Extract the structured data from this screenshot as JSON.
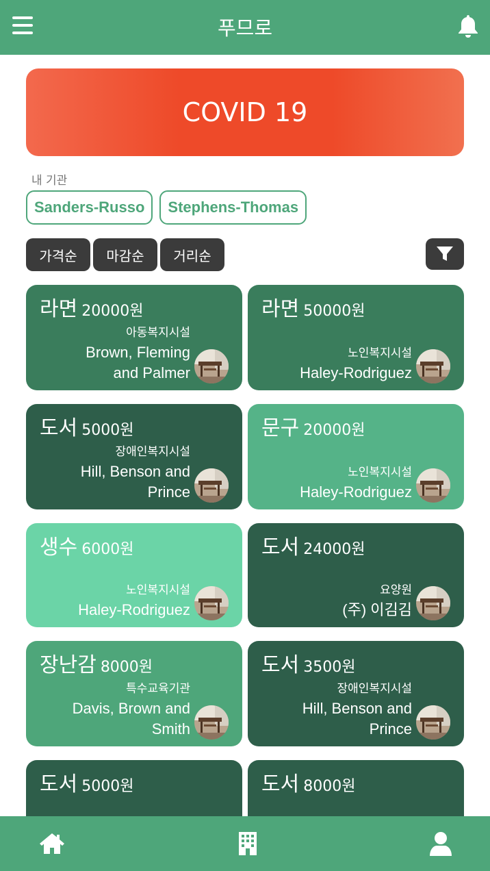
{
  "header": {
    "title": "푸므로",
    "menu_icon": "menu-icon",
    "bell_icon": "bell-icon"
  },
  "banner": {
    "text": "COVID 19"
  },
  "my_orgs": {
    "label": "내 기관",
    "items": [
      "Sanders-Russo",
      "Stephens-Thomas"
    ]
  },
  "sort": {
    "options": [
      "가격순",
      "마감순",
      "거리순"
    ],
    "filter_icon": "filter-icon"
  },
  "cards": [
    {
      "item": "라면",
      "price": "20000원",
      "type": "아동복지시설",
      "org_lines": [
        "Brown, Fleming",
        "and Palmer"
      ],
      "color": "#3a7d5c"
    },
    {
      "item": "라면",
      "price": "50000원",
      "type": "노인복지시설",
      "org_lines": [
        "Haley-Rodriguez"
      ],
      "color": "#3a7d5c"
    },
    {
      "item": "도서",
      "price": "5000원",
      "type": "장애인복지시설",
      "org_lines": [
        "Hill, Benson and",
        "Prince"
      ],
      "color": "#2e5e4a"
    },
    {
      "item": "문구",
      "price": "20000원",
      "type": "노인복지시설",
      "org_lines": [
        "Haley-Rodriguez"
      ],
      "color": "#55b388"
    },
    {
      "item": "생수",
      "price": "6000원",
      "type": "노인복지시설",
      "org_lines": [
        "Haley-Rodriguez"
      ],
      "color": "#6bd4a7"
    },
    {
      "item": "도서",
      "price": "24000원",
      "type": "요양원",
      "org_lines": [
        "(주) 이김김"
      ],
      "color": "#2e5e4a"
    },
    {
      "item": "장난감",
      "price": "8000원",
      "type": "특수교육기관",
      "org_lines": [
        "Davis, Brown and",
        "Smith"
      ],
      "color": "#4ea67a"
    },
    {
      "item": "도서",
      "price": "3500원",
      "type": "장애인복지시설",
      "org_lines": [
        "Hill, Benson and",
        "Prince"
      ],
      "color": "#2e5e4a"
    },
    {
      "item": "도서",
      "price": "5000원",
      "type": "",
      "org_lines": [],
      "color": "#2e5e4a"
    },
    {
      "item": "도서",
      "price": "8000원",
      "type": "",
      "org_lines": [],
      "color": "#2e5e4a"
    }
  ],
  "bottom_nav": [
    {
      "icon": "home-icon"
    },
    {
      "icon": "building-icon"
    },
    {
      "icon": "user-icon"
    }
  ]
}
